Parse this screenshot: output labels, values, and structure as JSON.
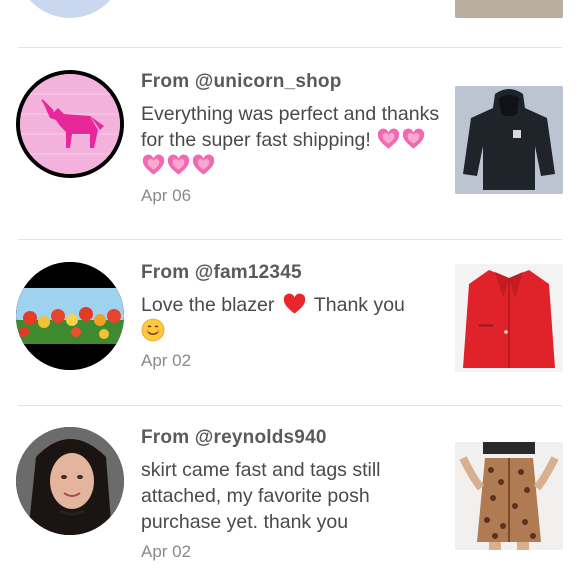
{
  "reviews": [
    {
      "from": "From @unicorn_shop",
      "message": "Everything was perfect and thanks for the super fast shipping!",
      "emoji": [
        "growing-heart",
        "growing-heart",
        "growing-heart",
        "growing-heart",
        "growing-heart"
      ],
      "date": "Apr 06",
      "avatar_icon": "unicorn-icon",
      "thumb": "black-hoodie"
    },
    {
      "from": "From @fam12345",
      "message_before": "Love the blazer",
      "message_after": "Thank you",
      "emoji": [
        "red-heart",
        "smiling-face"
      ],
      "date": "Apr 02",
      "avatar_icon": "tulips-photo",
      "thumb": "red-blazer"
    },
    {
      "from": "From @reynolds940",
      "message": "skirt came fast and tags still attached, my favorite posh purchase yet. thank you",
      "date": "Apr 02",
      "avatar_icon": "profile-photo",
      "thumb": "leopard-skirt"
    }
  ],
  "colors": {
    "text": "#4a4a4a",
    "date": "#8a8a8a",
    "divider": "#e3e3e3",
    "heart_pink": "#f06ab0",
    "heart_red": "#e8262b"
  }
}
